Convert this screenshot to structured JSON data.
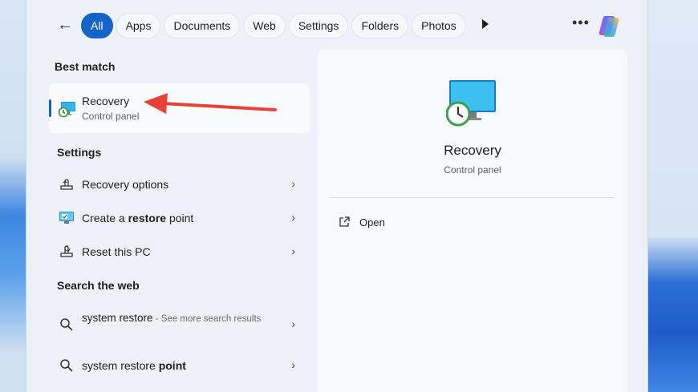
{
  "filters": {
    "back_icon": "arrow-left-icon",
    "chips": [
      "All",
      "Apps",
      "Documents",
      "Web",
      "Settings",
      "Folders",
      "Photos"
    ],
    "active_index": 0,
    "more_icon": "more-icon",
    "copilot_icon": "copilot-icon"
  },
  "best_match": {
    "heading": "Best match",
    "title": "Recovery",
    "subtitle": "Control panel"
  },
  "settings": {
    "heading": "Settings",
    "items": [
      {
        "label": "Recovery options",
        "icon": "recovery-options-icon"
      },
      {
        "label_pre": "Create a ",
        "label_bold": "restore",
        "label_post": " point",
        "icon": "system-properties-icon"
      },
      {
        "label": "Reset this PC",
        "icon": "reset-pc-icon"
      }
    ]
  },
  "web": {
    "heading": "Search the web",
    "items": [
      {
        "query": "system restore",
        "hint": " - See more search results",
        "icon": "search-icon"
      },
      {
        "query_pre": "system restore ",
        "query_bold": "point",
        "icon": "search-icon"
      }
    ]
  },
  "preview": {
    "title": "Recovery",
    "subtitle": "Control panel",
    "action_open": "Open",
    "action_icon": "open-external-icon"
  },
  "colors": {
    "accent": "#1463c8",
    "annotation_arrow": "#e8413a"
  }
}
